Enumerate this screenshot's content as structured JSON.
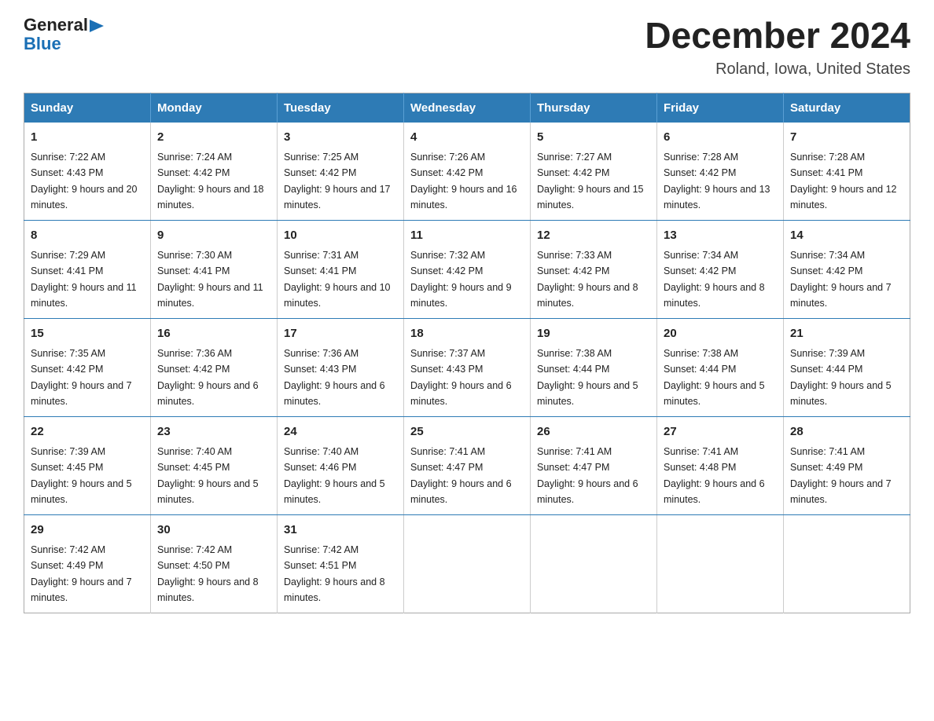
{
  "logo": {
    "general": "General",
    "blue": "Blue",
    "triangle": "▶"
  },
  "title": "December 2024",
  "location": "Roland, Iowa, United States",
  "weekdays": [
    "Sunday",
    "Monday",
    "Tuesday",
    "Wednesday",
    "Thursday",
    "Friday",
    "Saturday"
  ],
  "weeks": [
    [
      {
        "day": "1",
        "sunrise": "7:22 AM",
        "sunset": "4:43 PM",
        "daylight": "9 hours and 20 minutes."
      },
      {
        "day": "2",
        "sunrise": "7:24 AM",
        "sunset": "4:42 PM",
        "daylight": "9 hours and 18 minutes."
      },
      {
        "day": "3",
        "sunrise": "7:25 AM",
        "sunset": "4:42 PM",
        "daylight": "9 hours and 17 minutes."
      },
      {
        "day": "4",
        "sunrise": "7:26 AM",
        "sunset": "4:42 PM",
        "daylight": "9 hours and 16 minutes."
      },
      {
        "day": "5",
        "sunrise": "7:27 AM",
        "sunset": "4:42 PM",
        "daylight": "9 hours and 15 minutes."
      },
      {
        "day": "6",
        "sunrise": "7:28 AM",
        "sunset": "4:42 PM",
        "daylight": "9 hours and 13 minutes."
      },
      {
        "day": "7",
        "sunrise": "7:28 AM",
        "sunset": "4:41 PM",
        "daylight": "9 hours and 12 minutes."
      }
    ],
    [
      {
        "day": "8",
        "sunrise": "7:29 AM",
        "sunset": "4:41 PM",
        "daylight": "9 hours and 11 minutes."
      },
      {
        "day": "9",
        "sunrise": "7:30 AM",
        "sunset": "4:41 PM",
        "daylight": "9 hours and 11 minutes."
      },
      {
        "day": "10",
        "sunrise": "7:31 AM",
        "sunset": "4:41 PM",
        "daylight": "9 hours and 10 minutes."
      },
      {
        "day": "11",
        "sunrise": "7:32 AM",
        "sunset": "4:42 PM",
        "daylight": "9 hours and 9 minutes."
      },
      {
        "day": "12",
        "sunrise": "7:33 AM",
        "sunset": "4:42 PM",
        "daylight": "9 hours and 8 minutes."
      },
      {
        "day": "13",
        "sunrise": "7:34 AM",
        "sunset": "4:42 PM",
        "daylight": "9 hours and 8 minutes."
      },
      {
        "day": "14",
        "sunrise": "7:34 AM",
        "sunset": "4:42 PM",
        "daylight": "9 hours and 7 minutes."
      }
    ],
    [
      {
        "day": "15",
        "sunrise": "7:35 AM",
        "sunset": "4:42 PM",
        "daylight": "9 hours and 7 minutes."
      },
      {
        "day": "16",
        "sunrise": "7:36 AM",
        "sunset": "4:42 PM",
        "daylight": "9 hours and 6 minutes."
      },
      {
        "day": "17",
        "sunrise": "7:36 AM",
        "sunset": "4:43 PM",
        "daylight": "9 hours and 6 minutes."
      },
      {
        "day": "18",
        "sunrise": "7:37 AM",
        "sunset": "4:43 PM",
        "daylight": "9 hours and 6 minutes."
      },
      {
        "day": "19",
        "sunrise": "7:38 AM",
        "sunset": "4:44 PM",
        "daylight": "9 hours and 5 minutes."
      },
      {
        "day": "20",
        "sunrise": "7:38 AM",
        "sunset": "4:44 PM",
        "daylight": "9 hours and 5 minutes."
      },
      {
        "day": "21",
        "sunrise": "7:39 AM",
        "sunset": "4:44 PM",
        "daylight": "9 hours and 5 minutes."
      }
    ],
    [
      {
        "day": "22",
        "sunrise": "7:39 AM",
        "sunset": "4:45 PM",
        "daylight": "9 hours and 5 minutes."
      },
      {
        "day": "23",
        "sunrise": "7:40 AM",
        "sunset": "4:45 PM",
        "daylight": "9 hours and 5 minutes."
      },
      {
        "day": "24",
        "sunrise": "7:40 AM",
        "sunset": "4:46 PM",
        "daylight": "9 hours and 5 minutes."
      },
      {
        "day": "25",
        "sunrise": "7:41 AM",
        "sunset": "4:47 PM",
        "daylight": "9 hours and 6 minutes."
      },
      {
        "day": "26",
        "sunrise": "7:41 AM",
        "sunset": "4:47 PM",
        "daylight": "9 hours and 6 minutes."
      },
      {
        "day": "27",
        "sunrise": "7:41 AM",
        "sunset": "4:48 PM",
        "daylight": "9 hours and 6 minutes."
      },
      {
        "day": "28",
        "sunrise": "7:41 AM",
        "sunset": "4:49 PM",
        "daylight": "9 hours and 7 minutes."
      }
    ],
    [
      {
        "day": "29",
        "sunrise": "7:42 AM",
        "sunset": "4:49 PM",
        "daylight": "9 hours and 7 minutes."
      },
      {
        "day": "30",
        "sunrise": "7:42 AM",
        "sunset": "4:50 PM",
        "daylight": "9 hours and 8 minutes."
      },
      {
        "day": "31",
        "sunrise": "7:42 AM",
        "sunset": "4:51 PM",
        "daylight": "9 hours and 8 minutes."
      },
      null,
      null,
      null,
      null
    ]
  ]
}
